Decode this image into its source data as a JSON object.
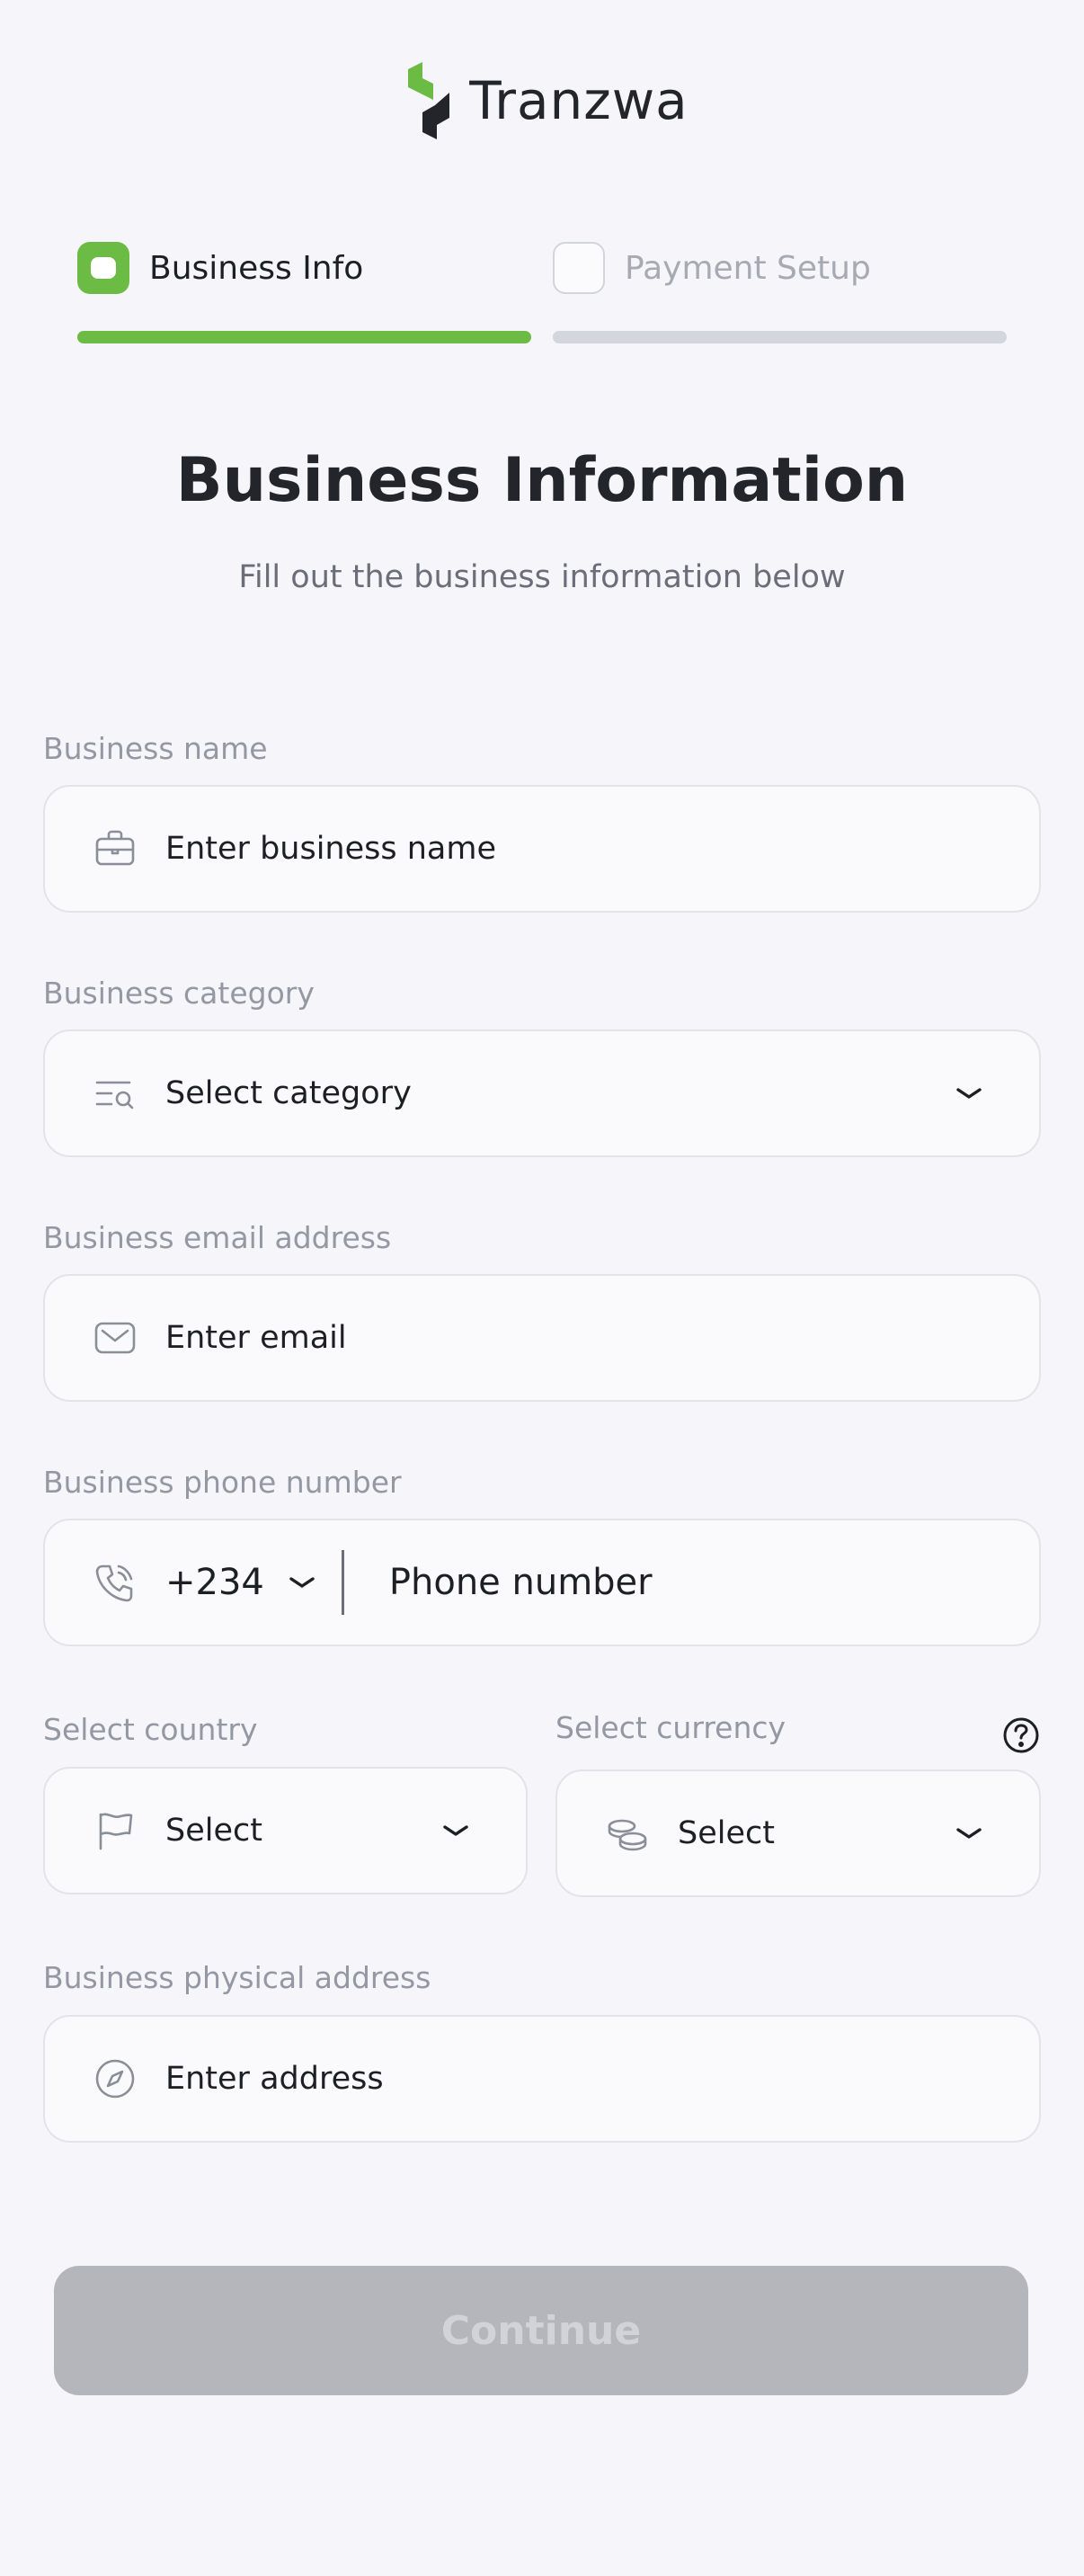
{
  "brand": {
    "name": "Tranzwa",
    "primary_color": "#6cbb45",
    "dark_color": "#24252b"
  },
  "steps": [
    {
      "label": "Business Info",
      "state": "active"
    },
    {
      "label": "Payment Setup",
      "state": "inactive"
    }
  ],
  "page": {
    "title": "Business Information",
    "subtitle": "Fill out the business information below"
  },
  "form": {
    "business_name": {
      "label": "Business name",
      "placeholder": "Enter business name",
      "icon": "briefcase-icon"
    },
    "business_category": {
      "label": "Business category",
      "placeholder": "Select category",
      "icon": "list-search-icon"
    },
    "business_email": {
      "label": "Business email address",
      "placeholder": "Enter email",
      "icon": "mail-icon"
    },
    "business_phone": {
      "label": "Business phone number",
      "country_code": "+234",
      "placeholder": "Phone number",
      "icon": "phone-icon"
    },
    "country": {
      "label": "Select country",
      "placeholder": "Select",
      "icon": "flag-icon"
    },
    "currency": {
      "label": "Select currency",
      "placeholder": "Select",
      "icon": "coins-icon",
      "help_icon": "question-circle-icon"
    },
    "address": {
      "label": "Business physical address",
      "placeholder": "Enter address",
      "icon": "compass-icon"
    }
  },
  "actions": {
    "continue_label": "Continue",
    "continue_enabled": false
  }
}
